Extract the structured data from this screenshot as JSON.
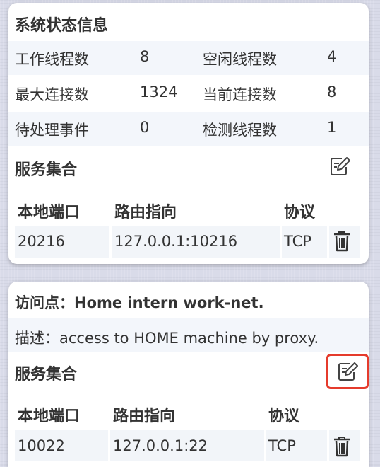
{
  "status_card": {
    "title": "系统状态信息",
    "rows": [
      {
        "l1": "工作线程数",
        "v1": "8",
        "l2": "空闲线程数",
        "v2": "4"
      },
      {
        "l1": "最大连接数",
        "v1": "1324",
        "l2": "当前连接数",
        "v2": "8"
      },
      {
        "l1": "待处理事件",
        "v1": "0",
        "l2": "检测线程数",
        "v2": "1"
      }
    ],
    "services_title": "服务集合",
    "columns": [
      "本地端口",
      "路由指向",
      "协议"
    ],
    "row": {
      "port": "20216",
      "route": "127.0.0.1:10216",
      "protocol": "TCP"
    }
  },
  "access_card": {
    "label": "访问点：",
    "name": "Home intern work-net.",
    "desc_label": "描述：",
    "description": "access to HOME machine by proxy.",
    "services_title": "服务集合",
    "columns": [
      "本地端口",
      "路由指向",
      "协议"
    ],
    "row": {
      "port": "10022",
      "route": "127.0.0.1:22",
      "protocol": "TCP"
    }
  },
  "icons": {
    "edit": "edit-icon",
    "delete": "trash-icon"
  },
  "colors": {
    "highlight": "#e53b2c",
    "shade": "#f3f6fb",
    "background": "#d9dbe9"
  }
}
